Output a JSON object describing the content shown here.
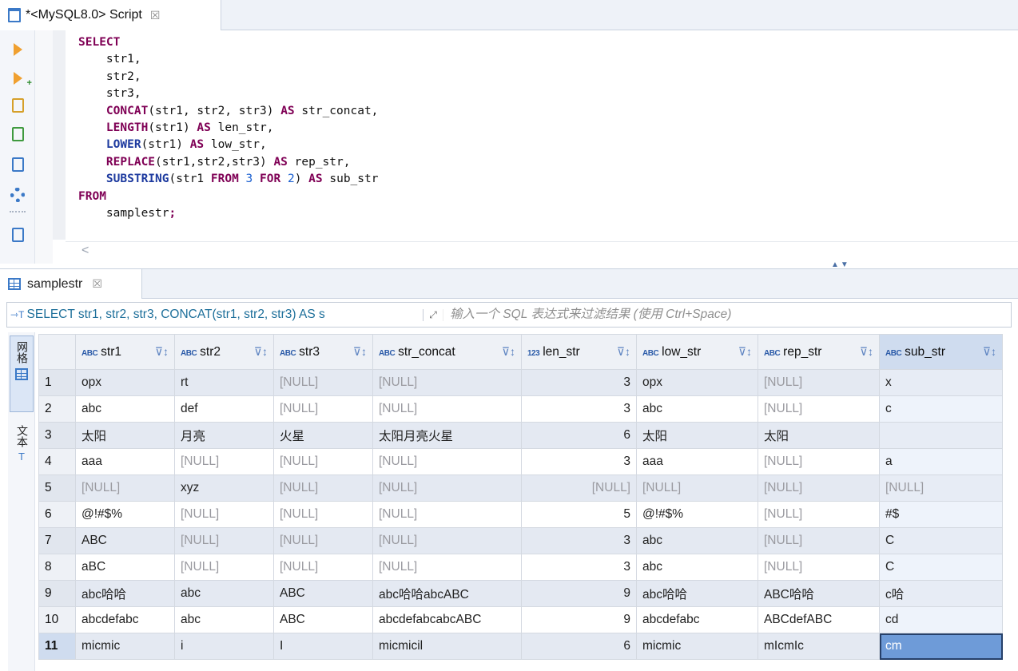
{
  "editor": {
    "tab_label": "*<MySQL8.0> Script",
    "tab_close": "☒",
    "sql_lines": [
      {
        "indent": "",
        "parts": [
          {
            "t": "kw",
            "v": "SELECT"
          }
        ]
      },
      {
        "indent": "    ",
        "parts": [
          {
            "t": "",
            "v": "str1,"
          }
        ]
      },
      {
        "indent": "    ",
        "parts": [
          {
            "t": "",
            "v": "str2,"
          }
        ]
      },
      {
        "indent": "    ",
        "parts": [
          {
            "t": "",
            "v": "str3,"
          }
        ]
      },
      {
        "indent": "    ",
        "parts": [
          {
            "t": "kw",
            "v": "CONCAT"
          },
          {
            "t": "",
            "v": "(str1, str2, str3) "
          },
          {
            "t": "kw",
            "v": "AS"
          },
          {
            "t": "",
            "v": " str_concat,"
          }
        ]
      },
      {
        "indent": "    ",
        "parts": [
          {
            "t": "kw",
            "v": "LENGTH"
          },
          {
            "t": "",
            "v": "(str1) "
          },
          {
            "t": "kw",
            "v": "AS"
          },
          {
            "t": "",
            "v": " len_str,"
          }
        ]
      },
      {
        "indent": "    ",
        "parts": [
          {
            "t": "fn",
            "v": "LOWER"
          },
          {
            "t": "",
            "v": "(str1) "
          },
          {
            "t": "kw",
            "v": "AS"
          },
          {
            "t": "",
            "v": " low_str,"
          }
        ]
      },
      {
        "indent": "    ",
        "parts": [
          {
            "t": "kw",
            "v": "REPLACE"
          },
          {
            "t": "",
            "v": "(str1,str2,str3) "
          },
          {
            "t": "kw",
            "v": "AS"
          },
          {
            "t": "",
            "v": " rep_str,"
          }
        ]
      },
      {
        "indent": "    ",
        "parts": [
          {
            "t": "fn",
            "v": "SUBSTRING"
          },
          {
            "t": "",
            "v": "(str1 "
          },
          {
            "t": "kw",
            "v": "FROM"
          },
          {
            "t": "",
            "v": " "
          },
          {
            "t": "num",
            "v": "3"
          },
          {
            "t": "",
            "v": " "
          },
          {
            "t": "kw",
            "v": "FOR"
          },
          {
            "t": "",
            "v": " "
          },
          {
            "t": "num",
            "v": "2"
          },
          {
            "t": "",
            "v": ") "
          },
          {
            "t": "kw",
            "v": "AS"
          },
          {
            "t": "",
            "v": " sub_str"
          }
        ]
      },
      {
        "indent": "",
        "parts": [
          {
            "t": "kw",
            "v": "FROM"
          }
        ]
      },
      {
        "indent": "    ",
        "parts": [
          {
            "t": "",
            "v": "samplestr"
          },
          {
            "t": "kw",
            "v": ";"
          }
        ]
      }
    ],
    "scroll_left": "<"
  },
  "results": {
    "tab_label": "samplestr",
    "tab_close": "☒",
    "filter_query": "SELECT str1, str2, str3, CONCAT(str1, str2, str3) AS s",
    "filter_placeholder": "输入一个 SQL 表达式来过滤结果 (使用 Ctrl+Space)",
    "side_tabs": [
      "网格",
      "文本"
    ],
    "columns": [
      {
        "type": "ABC",
        "name": "str1"
      },
      {
        "type": "ABC",
        "name": "str2"
      },
      {
        "type": "ABC",
        "name": "str3"
      },
      {
        "type": "ABC",
        "name": "str_concat"
      },
      {
        "type": "123",
        "name": "len_str"
      },
      {
        "type": "ABC",
        "name": "low_str"
      },
      {
        "type": "ABC",
        "name": "rep_str"
      },
      {
        "type": "ABC",
        "name": "sub_str"
      }
    ],
    "null_text": "[NULL]",
    "rows": [
      [
        "1",
        "opx",
        "rt",
        null,
        null,
        "3",
        "opx",
        null,
        "x"
      ],
      [
        "2",
        "abc",
        "def",
        null,
        null,
        "3",
        "abc",
        null,
        "c"
      ],
      [
        "3",
        "太阳",
        "月亮",
        "火星",
        "太阳月亮火星",
        "6",
        "太阳",
        "太阳",
        ""
      ],
      [
        "4",
        "aaa",
        null,
        null,
        null,
        "3",
        "aaa",
        null,
        "a"
      ],
      [
        "5",
        null,
        "xyz",
        null,
        null,
        null,
        null,
        null,
        null
      ],
      [
        "6",
        "@!#$%",
        null,
        null,
        null,
        "5",
        "@!#$%",
        null,
        "#$"
      ],
      [
        "7",
        "ABC",
        null,
        null,
        null,
        "3",
        "abc",
        null,
        "C"
      ],
      [
        "8",
        "aBC",
        null,
        null,
        null,
        "3",
        "abc",
        null,
        "C"
      ],
      [
        "9",
        "abc哈哈",
        "abc",
        "ABC",
        "abc哈哈abcABC",
        "9",
        "abc哈哈",
        "ABC哈哈",
        "c哈"
      ],
      [
        "10",
        "abcdefabc",
        "abc",
        "ABC",
        "abcdefabcabcABC",
        "9",
        "abcdefabc",
        "ABCdefABC",
        "cd"
      ],
      [
        "11",
        "micmic",
        "i",
        "I",
        "micmicil",
        "6",
        "micmic",
        "mIcmIc",
        "cm"
      ]
    ],
    "current_row": 11
  }
}
